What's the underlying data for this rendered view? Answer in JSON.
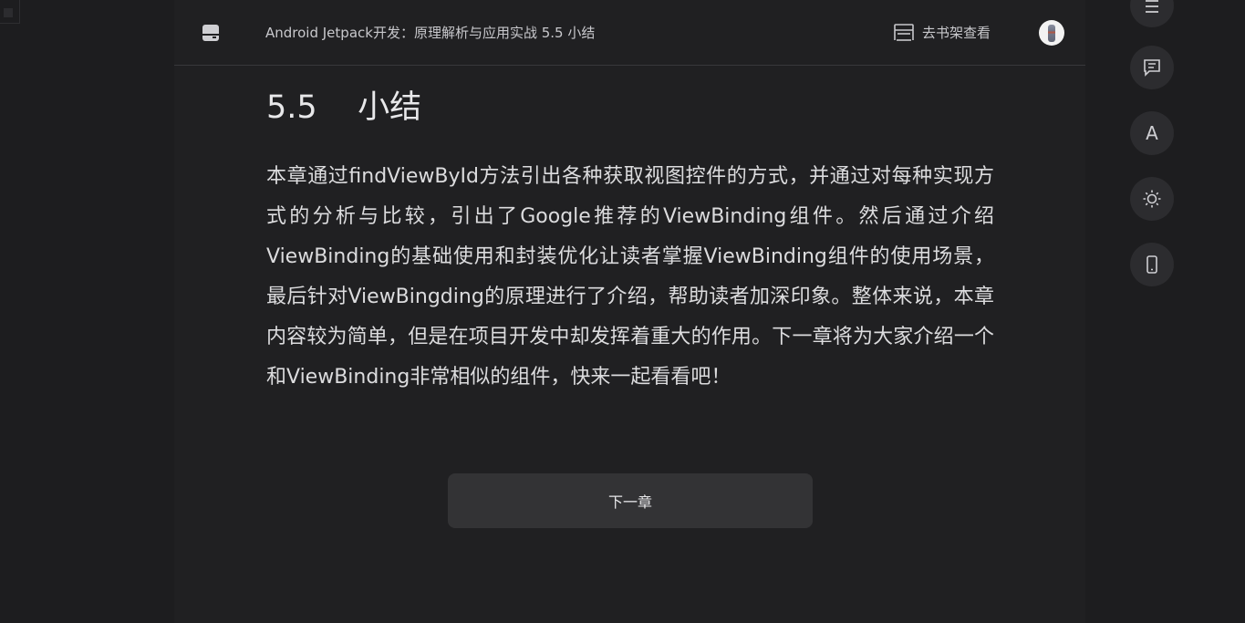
{
  "header": {
    "book_title": "Android Jetpack开发：原理解析与应用实战 5.5 小结",
    "shelf_label": "去书架查看"
  },
  "chapter": {
    "title": "5.5    小结",
    "body": "本章通过findViewById方法引出各种获取视图控件的方式，并通过对每种实现方式的分析与比较，引出了Google推荐的ViewBinding组件。然后通过介绍ViewBinding的基础使用和封装优化让读者掌握ViewBinding组件的使用场景，最后针对ViewBingding的原理进行了介绍，帮助读者加深印象。整体来说，本章内容较为简单，但是在项目开发中却发挥着重大的作用。下一章将为大家介绍一个和ViewBinding非常相似的组件，快来一起看看吧！"
  },
  "footer": {
    "next_label": "下一章"
  },
  "side_toolbar": {
    "font_letter": "A",
    "buttons": [
      "menu-icon",
      "comment-icon",
      "font-icon",
      "brightness-icon",
      "phone-icon"
    ]
  },
  "colors": {
    "page_bg": "#1d1d1f",
    "reader_bg": "#202022",
    "button_bg": "#333335",
    "side_button_bg": "#2c2c2f",
    "text": "#dcdcde"
  }
}
